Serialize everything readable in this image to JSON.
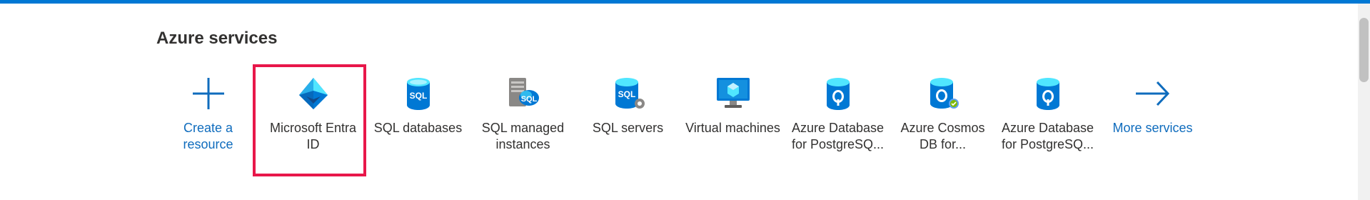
{
  "section": {
    "title": "Azure services"
  },
  "colors": {
    "accent": "#0078d4",
    "link": "#0f6cbd",
    "highlight": "#e8174a"
  },
  "services": [
    {
      "label": "Create a resource",
      "icon": "plus-icon",
      "is_link": true
    },
    {
      "label": "Microsoft Entra ID",
      "icon": "entra-id-icon",
      "is_link": false,
      "highlighted": true
    },
    {
      "label": "SQL databases",
      "icon": "sql-database-icon",
      "is_link": false
    },
    {
      "label": "SQL managed instances",
      "icon": "sql-managed-instance-icon",
      "is_link": false
    },
    {
      "label": "SQL servers",
      "icon": "sql-server-icon",
      "is_link": false
    },
    {
      "label": "Virtual machines",
      "icon": "virtual-machine-icon",
      "is_link": false
    },
    {
      "label": "Azure Database for PostgreSQ...",
      "icon": "postgresql-icon",
      "is_link": false
    },
    {
      "label": "Azure Cosmos DB for...",
      "icon": "cosmos-db-postgresql-icon",
      "is_link": false
    },
    {
      "label": "Azure Database for PostgreSQ...",
      "icon": "postgresql-flexible-icon",
      "is_link": false
    },
    {
      "label": "More services",
      "icon": "arrow-right-icon",
      "is_link": true
    }
  ]
}
